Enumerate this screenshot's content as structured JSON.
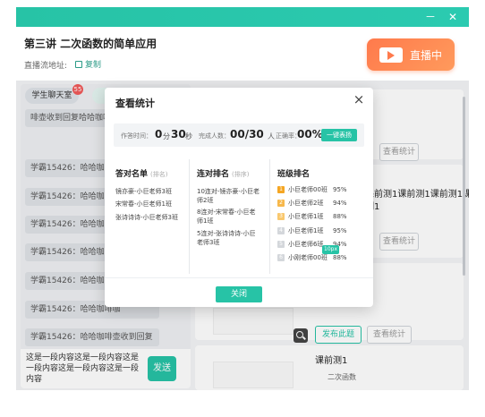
{
  "titlebar": {
    "minimize_icon": "－",
    "close_icon": "✕"
  },
  "header": {
    "title": "第三讲  二次函数的简单应用",
    "stream_label": "直播流地址:",
    "copy_label": "复制",
    "live_label": "直播中"
  },
  "chat": {
    "tab_students": "学生聊天室",
    "tab_teacher": "教",
    "badge_count": "55",
    "messages": [
      "啡壶收到回复哈哈咖啡",
      "学霸15426：哈哈咖啡咖",
      "学霸15426：哈哈咖啡咖",
      "学霸15426：哈哈咖啡咖",
      "学霸15426：哈哈咖啡咖",
      "学霸15426：哈哈咖啡咖",
      "学霸15426：哈哈咖啡咖",
      "学霸15426：哈哈咖啡壶收到回复"
    ],
    "input_text": "这是一段内容这是一段内容这是一段内容这是一段内容这是一段内容",
    "send_label": "发送"
  },
  "content": {
    "stats_label": "查看统计",
    "question_text": "课前测1课前测1课前测1课前",
    "question_text2": "测1",
    "publish_label": "发布此题",
    "question2_title": "课前测1",
    "question2_sub": "二次函数"
  },
  "modal": {
    "title": "查看统计",
    "stats": {
      "time_label": "作答时间：",
      "time_min": "0",
      "time_min_unit": "分",
      "time_sec": "30",
      "time_sec_unit": "秒",
      "done_label": "完成人数：",
      "done_value": "00/30",
      "done_unit": "人",
      "accuracy_label": "正确率：",
      "accuracy_value": "00%",
      "publish_label": "一键表扬"
    },
    "col_correct": {
      "heading": "答对名单",
      "sub": "(排名)",
      "items": [
        "镜亦豪-小巨老师3班",
        "宋常春-小巨老师1班",
        "张诗诗诗-小巨老师3班"
      ]
    },
    "col_streak": {
      "heading": "连对排名",
      "sub": "(排序)",
      "items": [
        [
          "10连对-镜亦豪-小巨老",
          "师2班"
        ],
        [
          "8连对-宋常春-小巨老",
          "师1班"
        ],
        [
          "5连对-张诗诗诗-小巨",
          "老师3班"
        ]
      ]
    },
    "col_class": {
      "heading": "班级排名",
      "items": [
        {
          "rank": "1",
          "name": "小巨老师00班",
          "pct": "95%"
        },
        {
          "rank": "2",
          "name": "小巨老师2班",
          "pct": "94%"
        },
        {
          "rank": "3",
          "name": "小巨老师1班",
          "pct": "88%"
        },
        {
          "rank": "4",
          "name": "小巨老师1班",
          "pct": "95%"
        },
        {
          "rank": "5",
          "name": "小巨老师6班",
          "pct": "94%"
        },
        {
          "rank": "6",
          "name": "小刚老师00班",
          "pct": "88%"
        }
      ],
      "tooltip": "10px"
    },
    "close_label": "关闭"
  },
  "colors": {
    "accent": "#27c3a6",
    "live": "#ff7a4c",
    "badge": "#f25a5a"
  }
}
